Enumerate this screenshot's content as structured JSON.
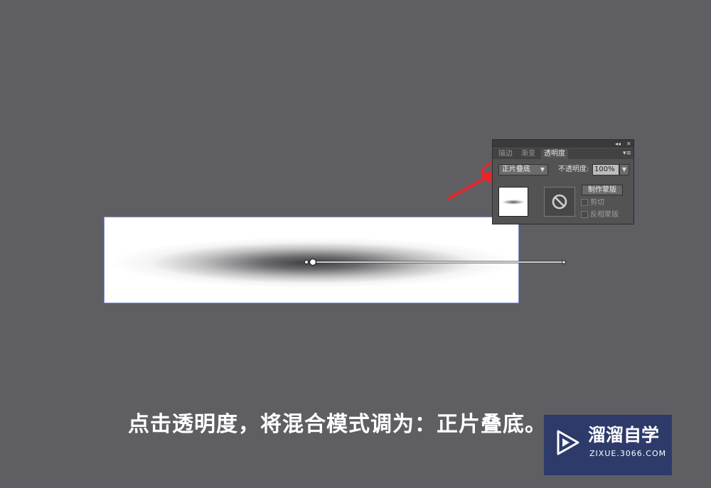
{
  "panel": {
    "tabs": [
      "描边",
      "渐变",
      "透明度"
    ],
    "active_tab": "透明度",
    "blend_mode": "正片叠底",
    "opacity_label": "不透明度:",
    "opacity_value": "100%",
    "make_mask_label": "制作蒙版",
    "clip_label": "剪切",
    "invert_mask_label": "反相蒙版",
    "collapse_icon": "double-chevron-left-icon",
    "close_icon": "close-icon",
    "menu_icon": "panel-menu-icon",
    "no_mask_icon": "prohibited-icon"
  },
  "caption": "点击透明度，将混合模式调为：正片叠底。",
  "watermark": {
    "title": "溜溜自学",
    "url": "ZIXUE.3066.COM",
    "logo_icon": "play-logo-icon"
  },
  "colors": {
    "canvas_bg": "#5f5e63",
    "annotation_red": "#e8262a",
    "watermark_bg": "#2d3a6a"
  }
}
